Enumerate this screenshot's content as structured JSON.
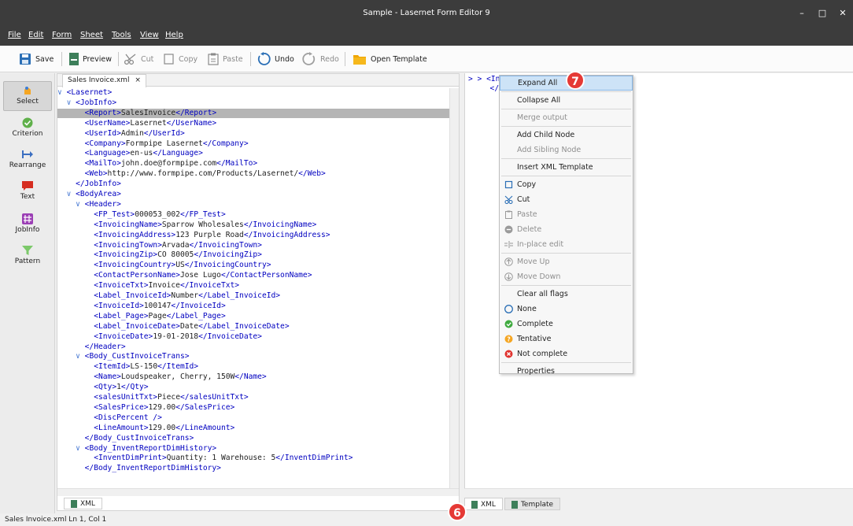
{
  "window": {
    "title": "Sample - Lasernet Form Editor 9",
    "minimize": "–",
    "maximize": "□",
    "close": "✕"
  },
  "menu": [
    "File",
    "Edit",
    "Form",
    "Sheet",
    "Tools",
    "View",
    "Help"
  ],
  "toolbar": {
    "save": "Save",
    "preview": "Preview",
    "cut": "Cut",
    "copy": "Copy",
    "paste": "Paste",
    "undo": "Undo",
    "redo": "Redo",
    "open_template": "Open Template"
  },
  "left_tools": [
    {
      "label": "Select"
    },
    {
      "label": "Criterion"
    },
    {
      "label": "Rearrange"
    },
    {
      "label": "Text"
    },
    {
      "label": "JobInfo"
    },
    {
      "label": "Pattern"
    }
  ],
  "editor": {
    "tab": "Sales Invoice.xml",
    "tab_close": "×",
    "bottom_tab": "XML",
    "lines": [
      "∨ <Lasernet>",
      "  ∨ <JobInfo>",
      "      <Report>SalesInvoice</Report>",
      "      <UserName>Lasernet</UserName>",
      "      <UserId>Admin</UserId>",
      "      <Company>Formpipe Lasernet</Company>",
      "      <Language>en-us</Language>",
      "      <MailTo>john.doe@formpipe.com</MailTo>",
      "      <Web>http://www.formpipe.com/Products/Lasernet/</Web>",
      "    </JobInfo>",
      "  ∨ <BodyArea>",
      "    ∨ <Header>",
      "        <FP_Test>000053_002</FP_Test>",
      "        <InvoicingName>Sparrow Wholesales</InvoicingName>",
      "        <InvoicingAddress>123 Purple Road</InvoicingAddress>",
      "        <InvoicingTown>Arvada</InvoicingTown>",
      "        <InvoicingZip>CO 80005</InvoicingZip>",
      "        <InvoicingCountry>US</InvoicingCountry>",
      "        <ContactPersonName>Jose Lugo</ContactPersonName>",
      "        <InvoiceTxt>Invoice</InvoiceTxt>",
      "        <Label_InvoiceId>Number</Label_InvoiceId>",
      "        <InvoiceId>100147</InvoiceId>",
      "        <Label_Page>Page</Label_Page>",
      "        <Label_InvoiceDate>Date</Label_InvoiceDate>",
      "        <InvoiceDate>19-01-2018</InvoiceDate>",
      "      </Header>",
      "    ∨ <Body_CustInvoiceTrans>",
      "        <ItemId>LS-150</ItemId>",
      "        <Name>Loudspeaker, Cherry, 150W</Name>",
      "        <Qty>1</Qty>",
      "        <salesUnitTxt>Piece</salesUnitTxt>",
      "        <SalesPrice>129.00</SalesPrice>",
      "        <DiscPercent />",
      "        <LineAmount>129.00</LineAmount>",
      "      </Body_CustInvoiceTrans>",
      "    ∨ <Body_InventReportDimHistory>",
      "        <InventDimPrint>Quantity: 1 Warehouse: 5</InventDimPrint>",
      "      </Body_InventReportDimHistory>"
    ]
  },
  "right_pane": {
    "line1": "> > <Invoice>",
    "line2": "  </I",
    "tabs": [
      "XML",
      "Template"
    ]
  },
  "context_menu": [
    {
      "label": "Expand All",
      "enabled": true,
      "hover": true
    },
    {
      "sep": true
    },
    {
      "label": "Collapse All",
      "enabled": true
    },
    {
      "sep": true
    },
    {
      "label": "Merge output",
      "enabled": false
    },
    {
      "sep": true
    },
    {
      "label": "Add Child Node",
      "enabled": true
    },
    {
      "label": "Add Sibling Node",
      "enabled": false
    },
    {
      "sep": true
    },
    {
      "label": "Insert XML Template",
      "enabled": true
    },
    {
      "sep": true
    },
    {
      "label": "Copy",
      "enabled": true,
      "icon": "copy-icon"
    },
    {
      "label": "Cut",
      "enabled": true,
      "icon": "cut-icon"
    },
    {
      "label": "Paste",
      "enabled": false,
      "icon": "paste-icon"
    },
    {
      "label": "Delete",
      "enabled": false,
      "icon": "delete-icon"
    },
    {
      "label": "In-place edit",
      "enabled": false,
      "icon": "edit-icon"
    },
    {
      "sep": true
    },
    {
      "label": "Move Up",
      "enabled": false,
      "icon": "up-icon"
    },
    {
      "label": "Move Down",
      "enabled": false,
      "icon": "down-icon"
    },
    {
      "sep": true
    },
    {
      "label": "Clear all flags",
      "enabled": true
    },
    {
      "label": "None",
      "enabled": true,
      "icon": "flag-none-icon"
    },
    {
      "label": "Complete",
      "enabled": true,
      "icon": "flag-complete-icon"
    },
    {
      "label": "Tentative",
      "enabled": true,
      "icon": "flag-tentative-icon"
    },
    {
      "label": "Not complete",
      "enabled": true,
      "icon": "flag-notcomplete-icon"
    },
    {
      "sep": true
    },
    {
      "label": "Properties",
      "enabled": true
    }
  ],
  "badges": [
    "7",
    "6"
  ],
  "status": "Sales Invoice.xml  Ln 1, Col 1",
  "colors": {
    "tag": "#0000c0",
    "title_bg": "#3c3c3c",
    "badge": "#e53935",
    "hover": "#cde3f7"
  }
}
